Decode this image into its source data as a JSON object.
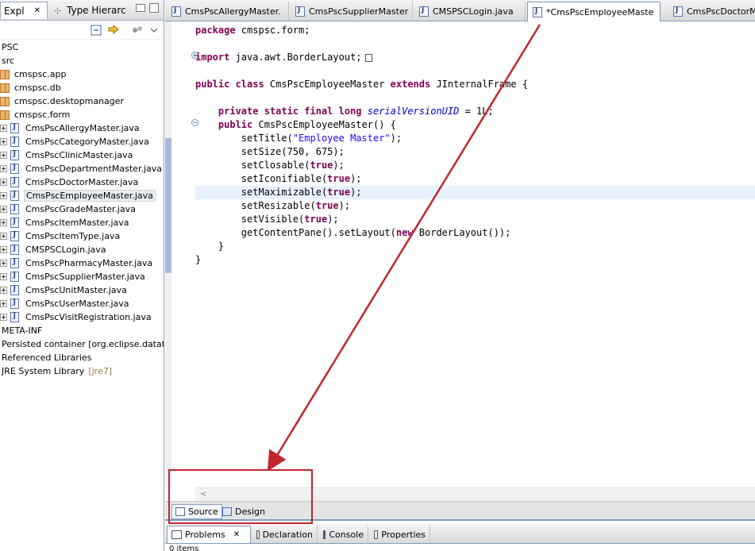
{
  "left_pane": {
    "tabs": [
      {
        "label": "Expl",
        "close": "✕"
      },
      {
        "label": "Type Hierarc"
      }
    ],
    "tree": [
      {
        "label": "PSC",
        "type": "project",
        "x": 0
      },
      {
        "label": "src",
        "type": "folder",
        "x": 0
      },
      {
        "label": "cmspsc.app",
        "type": "package",
        "x": 0
      },
      {
        "label": "cmspsc.db",
        "type": "package",
        "x": 0
      },
      {
        "label": "cmspsc.desktopmanager",
        "type": "package",
        "x": 0
      },
      {
        "label": "cmspsc.form",
        "type": "package",
        "x": 0
      },
      {
        "label": "CmsPscAllergyMaster.java",
        "type": "java"
      },
      {
        "label": "CmsPscCategoryMaster.java",
        "type": "java"
      },
      {
        "label": "CmsPscClinicMaster.java",
        "type": "java"
      },
      {
        "label": "CmsPscDepartmentMaster.java",
        "type": "java"
      },
      {
        "label": "CmsPscDoctorMaster.java",
        "type": "java"
      },
      {
        "label": "CmsPscEmployeeMaster.java",
        "type": "java",
        "selected": true
      },
      {
        "label": "CmsPscGradeMaster.java",
        "type": "java"
      },
      {
        "label": "CmsPscItemMaster.java",
        "type": "java"
      },
      {
        "label": "CmsPscItemType.java",
        "type": "java"
      },
      {
        "label": "CMSPSCLogin.java",
        "type": "java"
      },
      {
        "label": "CmsPscPharmacyMaster.java",
        "type": "java"
      },
      {
        "label": "CmsPscSupplierMaster.java",
        "type": "java"
      },
      {
        "label": "CmsPscUnitMaster.java",
        "type": "java"
      },
      {
        "label": "CmsPscUserMaster.java",
        "type": "java"
      },
      {
        "label": "CmsPscVisitRegistration.java",
        "type": "java"
      },
      {
        "label": "META-INF",
        "type": "folder"
      },
      {
        "label": "Persisted container [org.eclipse.datatools.c",
        "type": "container"
      },
      {
        "label": "Referenced Libraries",
        "type": "library"
      },
      {
        "label": "JRE System Library",
        "type": "library",
        "suffix": "[jre7]"
      }
    ]
  },
  "editor": {
    "tabs": [
      {
        "label": "CmsPscAllergyMaster."
      },
      {
        "label": "CmsPscSupplierMaster"
      },
      {
        "label": "CMSPSCLogin.java"
      },
      {
        "label": "*CmsPscEmployeeMaste",
        "active": true,
        "close": "✕"
      },
      {
        "label": "CmsPscDoctorMa"
      }
    ],
    "code": {
      "l1_kw": "package",
      "l1_rest": " cmspsc.form;",
      "l2_kw": "import",
      "l2_rest": " java.awt.BorderLayout;",
      "l3_kw1": "public class",
      "l3_name": " CmsPscEmployeeMaster ",
      "l3_kw2": "extends",
      "l3_rest": " JInternalFrame {",
      "l4_kw": "private static final long",
      "l4_field": "serialVersionUID",
      "l4_rest": " = 1L;",
      "l5_kw": "public",
      "l5_rest": " CmsPscEmployeeMaster() {",
      "l6_a": "setTitle(",
      "l6_str": "\"Employee Master\"",
      "l6_b": ");",
      "l7": "setSize(750, 675);",
      "l8_a": "setClosable(",
      "l8_kw": "true",
      "l8_b": ");",
      "l9_a": "setIconifiable(",
      "l9_kw": "true",
      "l9_b": ");",
      "l10_a": "setMaximizable(",
      "l10_kw": "true",
      "l10_b": ");",
      "l11_a": "setResizable(",
      "l11_kw": "true",
      "l11_b": ");",
      "l12_a": "setVisible(",
      "l12_kw": "true",
      "l12_b": ");",
      "l13_a": "getContentPane().setLayout(",
      "l13_kw": "new",
      "l13_b": " BorderLayout());",
      "l14": "}",
      "l15": "}"
    },
    "hscroll_left": "<",
    "source_tab": "Source",
    "design_tab": "Design"
  },
  "bottom": {
    "tabs": [
      {
        "label": "Problems",
        "close": "✕",
        "active": true
      },
      {
        "label": "Declaration"
      },
      {
        "label": "Console"
      },
      {
        "label": "Properties"
      }
    ],
    "status": "0 items"
  },
  "colors": {
    "annotation": "#c0272d",
    "keyword": "#7f0055",
    "string": "#2a00ff",
    "field": "#0000c0"
  }
}
